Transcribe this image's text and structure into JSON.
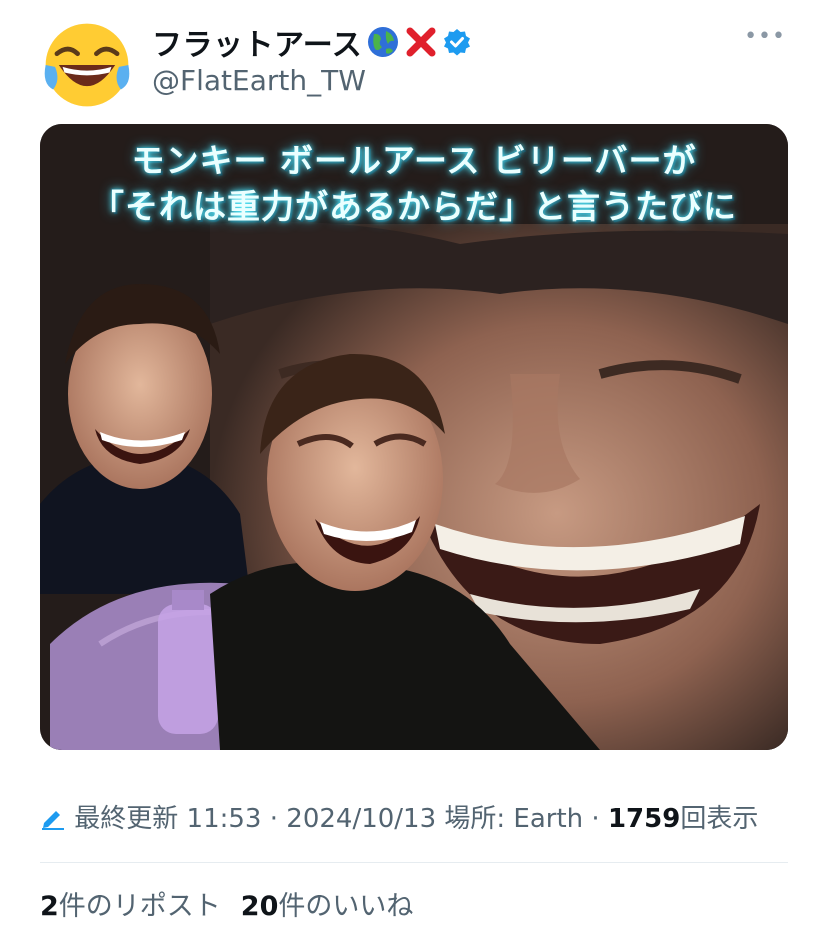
{
  "tweet": {
    "display_name": "フラットアース",
    "handle": "@FlatEarth_TW",
    "more_icon": "more-icon",
    "verified_color": "#1d9bf0"
  },
  "image": {
    "caption_line1": "モンキー ボールアース ビリーバーが",
    "caption_line2": "「それは重力があるからだ」と言うたびに"
  },
  "meta": {
    "edit_label": "最終更新",
    "time": "11:53",
    "date": "2024/10/13",
    "location": "場所: Earth",
    "views_count": "1759",
    "views_label": "回表示"
  },
  "stats": {
    "reposts_count": "2",
    "reposts_label": "件のリポスト",
    "likes_count": "20",
    "likes_label": "件のいいね"
  }
}
